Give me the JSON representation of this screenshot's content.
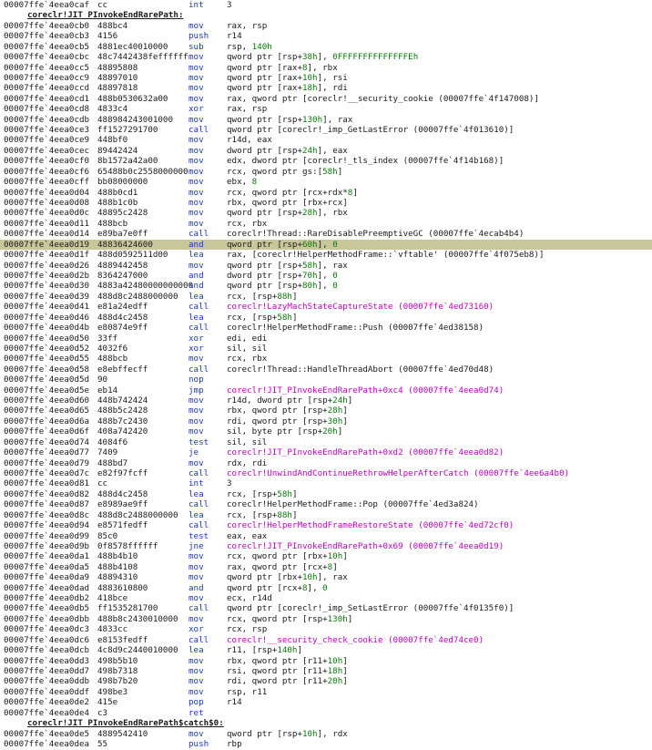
{
  "colors": {
    "mnemonic": "#1a36c8",
    "link": "#c000c0",
    "highlight": "#c8c79a",
    "number": "#0a7a0a"
  },
  "rows": [
    {
      "addr": "00007ffe`4eea0caf",
      "bytes": "cc",
      "mn": "int",
      "ops": [
        {
          "t": "3"
        }
      ]
    },
    {
      "label": "coreclr!JIT_PInvokeEndRarePath:"
    },
    {
      "addr": "00007ffe`4eea0cb0",
      "bytes": "488bc4",
      "mn": "mov",
      "ops": [
        {
          "t": "rax, rsp"
        }
      ]
    },
    {
      "addr": "00007ffe`4eea0cb3",
      "bytes": "4156",
      "mn": "push",
      "ops": [
        {
          "t": "r14"
        }
      ]
    },
    {
      "addr": "00007ffe`4eea0cb5",
      "bytes": "4881ec40010000",
      "mn": "sub",
      "ops": [
        {
          "t": "rsp, "
        },
        {
          "t": "140h",
          "k": "num"
        }
      ]
    },
    {
      "addr": "00007ffe`4eea0cbc",
      "bytes": "48c7442438feffffff",
      "mn": "mov",
      "ops": [
        {
          "t": "qword ptr [rsp+"
        },
        {
          "t": "38h",
          "k": "num"
        },
        {
          "t": "], "
        },
        {
          "t": "0FFFFFFFFFFFFFFEh",
          "k": "num"
        }
      ]
    },
    {
      "addr": "00007ffe`4eea0cc5",
      "bytes": "48895808",
      "mn": "mov",
      "ops": [
        {
          "t": "qword ptr [rax+"
        },
        {
          "t": "8",
          "k": "num"
        },
        {
          "t": "], rbx"
        }
      ]
    },
    {
      "addr": "00007ffe`4eea0cc9",
      "bytes": "48897010",
      "mn": "mov",
      "ops": [
        {
          "t": "qword ptr [rax+"
        },
        {
          "t": "10h",
          "k": "num"
        },
        {
          "t": "], rsi"
        }
      ]
    },
    {
      "addr": "00007ffe`4eea0ccd",
      "bytes": "48897818",
      "mn": "mov",
      "ops": [
        {
          "t": "qword ptr [rax+"
        },
        {
          "t": "18h",
          "k": "num"
        },
        {
          "t": "], rdi"
        }
      ]
    },
    {
      "addr": "00007ffe`4eea0cd1",
      "bytes": "488b0530632a00",
      "mn": "mov",
      "ops": [
        {
          "t": "rax, qword ptr [coreclr!__security_cookie (00007ffe`4f147008)]"
        }
      ]
    },
    {
      "addr": "00007ffe`4eea0cd8",
      "bytes": "4833c4",
      "mn": "xor",
      "ops": [
        {
          "t": "rax, rsp"
        }
      ]
    },
    {
      "addr": "00007ffe`4eea0cdb",
      "bytes": "488984243001000",
      "mn": "mov",
      "ops": [
        {
          "t": "qword ptr [rsp+"
        },
        {
          "t": "130h",
          "k": "num"
        },
        {
          "t": "], rax"
        }
      ]
    },
    {
      "addr": "00007ffe`4eea0ce3",
      "bytes": "ff1527291700",
      "mn": "call",
      "ops": [
        {
          "t": "qword ptr [coreclr!_imp_GetLastError (00007ffe`4f013610)]"
        }
      ]
    },
    {
      "addr": "00007ffe`4eea0ce9",
      "bytes": "448bf0",
      "mn": "mov",
      "ops": [
        {
          "t": "r14d, eax"
        }
      ]
    },
    {
      "addr": "00007ffe`4eea0cec",
      "bytes": "89442424",
      "mn": "mov",
      "ops": [
        {
          "t": "dword ptr [rsp+"
        },
        {
          "t": "24h",
          "k": "num"
        },
        {
          "t": "], eax"
        }
      ]
    },
    {
      "addr": "00007ffe`4eea0cf0",
      "bytes": "8b1572a42a00",
      "mn": "mov",
      "ops": [
        {
          "t": "edx, dword ptr [coreclr!_tls_index (00007ffe`4f14b168)]"
        }
      ]
    },
    {
      "addr": "00007ffe`4eea0cf6",
      "bytes": "65488b0c2558000000",
      "mn": "mov",
      "ops": [
        {
          "t": "rcx, qword ptr gs:["
        },
        {
          "t": "58h",
          "k": "num"
        },
        {
          "t": "]"
        }
      ]
    },
    {
      "addr": "00007ffe`4eea0cff",
      "bytes": "bb08000000",
      "mn": "mov",
      "ops": [
        {
          "t": "ebx, "
        },
        {
          "t": "8",
          "k": "num"
        }
      ]
    },
    {
      "addr": "00007ffe`4eea0d04",
      "bytes": "488b0cd1",
      "mn": "mov",
      "ops": [
        {
          "t": "rcx, qword ptr [rcx+rdx*"
        },
        {
          "t": "8",
          "k": "num"
        },
        {
          "t": "]"
        }
      ]
    },
    {
      "addr": "00007ffe`4eea0d08",
      "bytes": "488b1c0b",
      "mn": "mov",
      "ops": [
        {
          "t": "rbx, qword ptr [rbx+rcx]"
        }
      ]
    },
    {
      "addr": "00007ffe`4eea0d0c",
      "bytes": "48895c2428",
      "mn": "mov",
      "ops": [
        {
          "t": "qword ptr [rsp+"
        },
        {
          "t": "28h",
          "k": "num"
        },
        {
          "t": "], rbx"
        }
      ]
    },
    {
      "addr": "00007ffe`4eea0d11",
      "bytes": "488bcb",
      "mn": "mov",
      "ops": [
        {
          "t": "rcx, rbx"
        }
      ]
    },
    {
      "addr": "00007ffe`4eea0d14",
      "bytes": "e89ba7e0ff",
      "mn": "call",
      "ops": [
        {
          "t": "coreclr!Thread::RareDisablePreemptiveGC (00007ffe`4ecab4b4)"
        }
      ]
    },
    {
      "addr": "00007ffe`4eea0d19",
      "bytes": "48836424600",
      "mn": "and",
      "current": true,
      "ops": [
        {
          "t": "qword ptr [rsp+"
        },
        {
          "t": "60h",
          "k": "num"
        },
        {
          "t": "], "
        },
        {
          "t": "0",
          "k": "num"
        }
      ]
    },
    {
      "addr": "00007ffe`4eea0d1f",
      "bytes": "488d0592511d00",
      "mn": "lea",
      "ops": [
        {
          "t": "rax, [coreclr!HelperMethodFrame::`vftable' (00007ffe`4f075eb8)]"
        }
      ]
    },
    {
      "addr": "00007ffe`4eea0d26",
      "bytes": "4889442458",
      "mn": "mov",
      "ops": [
        {
          "t": "qword ptr [rsp+"
        },
        {
          "t": "58h",
          "k": "num"
        },
        {
          "t": "], rax"
        }
      ]
    },
    {
      "addr": "00007ffe`4eea0d2b",
      "bytes": "8364247000",
      "mn": "and",
      "ops": [
        {
          "t": "dword ptr [rsp+"
        },
        {
          "t": "70h",
          "k": "num"
        },
        {
          "t": "], "
        },
        {
          "t": "0",
          "k": "num"
        }
      ]
    },
    {
      "addr": "00007ffe`4eea0d30",
      "bytes": "4883a42480000000000",
      "mn": "and",
      "ops": [
        {
          "t": "qword ptr [rsp+"
        },
        {
          "t": "80h",
          "k": "num"
        },
        {
          "t": "], "
        },
        {
          "t": "0",
          "k": "num"
        }
      ]
    },
    {
      "addr": "00007ffe`4eea0d39",
      "bytes": "488d8c2488000000",
      "mn": "lea",
      "ops": [
        {
          "t": "rcx, [rsp+"
        },
        {
          "t": "88h",
          "k": "num"
        },
        {
          "t": "]"
        }
      ]
    },
    {
      "addr": "00007ffe`4eea0d41",
      "bytes": "e81a24edff",
      "mn": "call",
      "ops": [
        {
          "t": "coreclr!LazyMachStateCaptureState (00007ffe`4ed73160)",
          "k": "link"
        }
      ]
    },
    {
      "addr": "00007ffe`4eea0d46",
      "bytes": "488d4c2458",
      "mn": "lea",
      "ops": [
        {
          "t": "rcx, [rsp+"
        },
        {
          "t": "58h",
          "k": "num"
        },
        {
          "t": "]"
        }
      ]
    },
    {
      "addr": "00007ffe`4eea0d4b",
      "bytes": "e80874e9ff",
      "mn": "call",
      "ops": [
        {
          "t": "coreclr!HelperMethodFrame::Push (00007ffe`4ed38158)"
        }
      ]
    },
    {
      "addr": "00007ffe`4eea0d50",
      "bytes": "33ff",
      "mn": "xor",
      "ops": [
        {
          "t": "edi, edi"
        }
      ]
    },
    {
      "addr": "00007ffe`4eea0d52",
      "bytes": "4032f6",
      "mn": "xor",
      "ops": [
        {
          "t": "sil, sil"
        }
      ]
    },
    {
      "addr": "00007ffe`4eea0d55",
      "bytes": "488bcb",
      "mn": "mov",
      "ops": [
        {
          "t": "rcx, rbx"
        }
      ]
    },
    {
      "addr": "00007ffe`4eea0d58",
      "bytes": "e8ebffecff",
      "mn": "call",
      "ops": [
        {
          "t": "coreclr!Thread::HandleThreadAbort (00007ffe`4ed70d48)"
        }
      ]
    },
    {
      "addr": "00007ffe`4eea0d5d",
      "bytes": "90",
      "mn": "nop",
      "ops": []
    },
    {
      "addr": "00007ffe`4eea0d5e",
      "bytes": "eb14",
      "mn": "jmp",
      "ops": [
        {
          "t": "coreclr!JIT_PInvokeEndRarePath+0xc4 (00007ffe`4eea0d74)",
          "k": "link"
        }
      ]
    },
    {
      "addr": "00007ffe`4eea0d60",
      "bytes": "448b742424",
      "mn": "mov",
      "ops": [
        {
          "t": "r14d, dword ptr [rsp+"
        },
        {
          "t": "24h",
          "k": "num"
        },
        {
          "t": "]"
        }
      ]
    },
    {
      "addr": "00007ffe`4eea0d65",
      "bytes": "488b5c2428",
      "mn": "mov",
      "ops": [
        {
          "t": "rbx, qword ptr [rsp+"
        },
        {
          "t": "28h",
          "k": "num"
        },
        {
          "t": "]"
        }
      ]
    },
    {
      "addr": "00007ffe`4eea0d6a",
      "bytes": "488b7c2430",
      "mn": "mov",
      "ops": [
        {
          "t": "rdi, qword ptr [rsp+"
        },
        {
          "t": "30h",
          "k": "num"
        },
        {
          "t": "]"
        }
      ]
    },
    {
      "addr": "00007ffe`4eea0d6f",
      "bytes": "408a742420",
      "mn": "mov",
      "ops": [
        {
          "t": "sil, byte ptr [rsp+"
        },
        {
          "t": "20h",
          "k": "num"
        },
        {
          "t": "]"
        }
      ]
    },
    {
      "addr": "00007ffe`4eea0d74",
      "bytes": "4084f6",
      "mn": "test",
      "ops": [
        {
          "t": "sil, sil"
        }
      ]
    },
    {
      "addr": "00007ffe`4eea0d77",
      "bytes": "7409",
      "mn": "je",
      "ops": [
        {
          "t": "coreclr!JIT_PInvokeEndRarePath+0xd2 (00007ffe`4eea0d82)",
          "k": "link"
        }
      ]
    },
    {
      "addr": "00007ffe`4eea0d79",
      "bytes": "488bd7",
      "mn": "mov",
      "ops": [
        {
          "t": "rdx, rdi"
        }
      ]
    },
    {
      "addr": "00007ffe`4eea0d7c",
      "bytes": "e82f97fcff",
      "mn": "call",
      "ops": [
        {
          "t": "coreclr!UnwindAndContinueRethrowHelperAfterCatch (00007ffe`4ee6a4b0)",
          "k": "link"
        }
      ]
    },
    {
      "addr": "00007ffe`4eea0d81",
      "bytes": "cc",
      "mn": "int",
      "ops": [
        {
          "t": "3"
        }
      ]
    },
    {
      "addr": "00007ffe`4eea0d82",
      "bytes": "488d4c2458",
      "mn": "lea",
      "ops": [
        {
          "t": "rcx, [rsp+"
        },
        {
          "t": "58h",
          "k": "num"
        },
        {
          "t": "]"
        }
      ]
    },
    {
      "addr": "00007ffe`4eea0d87",
      "bytes": "e8989ae9ff",
      "mn": "call",
      "ops": [
        {
          "t": "coreclr!HelperMethodFrame::Pop (00007ffe`4ed3a824)"
        }
      ]
    },
    {
      "addr": "00007ffe`4eea0d8c",
      "bytes": "488d8c2488000000",
      "mn": "lea",
      "ops": [
        {
          "t": "rcx, [rsp+"
        },
        {
          "t": "88h",
          "k": "num"
        },
        {
          "t": "]"
        }
      ]
    },
    {
      "addr": "00007ffe`4eea0d94",
      "bytes": "e8571fedff",
      "mn": "call",
      "ops": [
        {
          "t": "coreclr!HelperMethodFrameRestoreState (00007ffe`4ed72cf0)",
          "k": "link"
        }
      ]
    },
    {
      "addr": "00007ffe`4eea0d99",
      "bytes": "85c0",
      "mn": "test",
      "ops": [
        {
          "t": "eax, eax"
        }
      ]
    },
    {
      "addr": "00007ffe`4eea0d9b",
      "bytes": "0f8578ffffff",
      "mn": "jne",
      "ops": [
        {
          "t": "coreclr!JIT_PInvokeEndRarePath+0x69 (00007ffe`4eea0d19)",
          "k": "link"
        }
      ]
    },
    {
      "addr": "00007ffe`4eea0da1",
      "bytes": "488b4b10",
      "mn": "mov",
      "ops": [
        {
          "t": "rcx, qword ptr [rbx+"
        },
        {
          "t": "10h",
          "k": "num"
        },
        {
          "t": "]"
        }
      ]
    },
    {
      "addr": "00007ffe`4eea0da5",
      "bytes": "488b4108",
      "mn": "mov",
      "ops": [
        {
          "t": "rax, qword ptr [rcx+"
        },
        {
          "t": "8",
          "k": "num"
        },
        {
          "t": "]"
        }
      ]
    },
    {
      "addr": "00007ffe`4eea0da9",
      "bytes": "48894310",
      "mn": "mov",
      "ops": [
        {
          "t": "qword ptr [rbx+"
        },
        {
          "t": "10h",
          "k": "num"
        },
        {
          "t": "], rax"
        }
      ]
    },
    {
      "addr": "00007ffe`4eea0dad",
      "bytes": "4883610800",
      "mn": "and",
      "ops": [
        {
          "t": "qword ptr [rcx+"
        },
        {
          "t": "8",
          "k": "num"
        },
        {
          "t": "], "
        },
        {
          "t": "0",
          "k": "num"
        }
      ]
    },
    {
      "addr": "00007ffe`4eea0db2",
      "bytes": "418bce",
      "mn": "mov",
      "ops": [
        {
          "t": "ecx, r14d"
        }
      ]
    },
    {
      "addr": "00007ffe`4eea0db5",
      "bytes": "ff1535281700",
      "mn": "call",
      "ops": [
        {
          "t": "qword ptr [coreclr!_imp_SetLastError (00007ffe`4f0135f0)]"
        }
      ]
    },
    {
      "addr": "00007ffe`4eea0dbb",
      "bytes": "488b8c2430010000",
      "mn": "mov",
      "ops": [
        {
          "t": "rcx, qword ptr [rsp+"
        },
        {
          "t": "130h",
          "k": "num"
        },
        {
          "t": "]"
        }
      ]
    },
    {
      "addr": "00007ffe`4eea0dc3",
      "bytes": "4833cc",
      "mn": "xor",
      "ops": [
        {
          "t": "rcx, rsp"
        }
      ]
    },
    {
      "addr": "00007ffe`4eea0dc6",
      "bytes": "e8153fedff",
      "mn": "call",
      "ops": [
        {
          "t": "coreclr!__security_check_cookie (00007ffe`4ed74ce0)",
          "k": "link"
        }
      ]
    },
    {
      "addr": "00007ffe`4eea0dcb",
      "bytes": "4c8d9c2440010000",
      "mn": "lea",
      "ops": [
        {
          "t": "r11, [rsp+"
        },
        {
          "t": "140h",
          "k": "num"
        },
        {
          "t": "]"
        }
      ]
    },
    {
      "addr": "00007ffe`4eea0dd3",
      "bytes": "498b5b10",
      "mn": "mov",
      "ops": [
        {
          "t": "rbx, qword ptr [r11+"
        },
        {
          "t": "10h",
          "k": "num"
        },
        {
          "t": "]"
        }
      ]
    },
    {
      "addr": "00007ffe`4eea0dd7",
      "bytes": "498b7318",
      "mn": "mov",
      "ops": [
        {
          "t": "rsi, qword ptr [r11+"
        },
        {
          "t": "18h",
          "k": "num"
        },
        {
          "t": "]"
        }
      ]
    },
    {
      "addr": "00007ffe`4eea0ddb",
      "bytes": "498b7b20",
      "mn": "mov",
      "ops": [
        {
          "t": "rdi, qword ptr [r11+"
        },
        {
          "t": "20h",
          "k": "num"
        },
        {
          "t": "]"
        }
      ]
    },
    {
      "addr": "00007ffe`4eea0ddf",
      "bytes": "498be3",
      "mn": "mov",
      "ops": [
        {
          "t": "rsp, r11"
        }
      ]
    },
    {
      "addr": "00007ffe`4eea0de2",
      "bytes": "415e",
      "mn": "pop",
      "ops": [
        {
          "t": "r14"
        }
      ]
    },
    {
      "addr": "00007ffe`4eea0de4",
      "bytes": "c3",
      "mn": "ret",
      "ops": []
    },
    {
      "label": "coreclr!JIT_PInvokeEndRarePath$catch$0:"
    },
    {
      "addr": "00007ffe`4eea0de5",
      "bytes": "4889542410",
      "mn": "mov",
      "ops": [
        {
          "t": "qword ptr [rsp+"
        },
        {
          "t": "10h",
          "k": "num"
        },
        {
          "t": "], rdx"
        }
      ]
    },
    {
      "addr": "00007ffe`4eea0dea",
      "bytes": "55",
      "mn": "push",
      "ops": [
        {
          "t": "rbp"
        }
      ]
    }
  ]
}
